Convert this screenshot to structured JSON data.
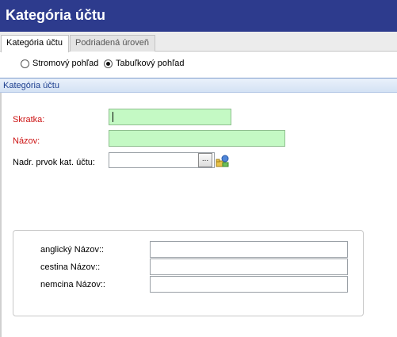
{
  "window": {
    "title": "Kategória účtu"
  },
  "tabs": [
    {
      "label": "Kategória účtu",
      "active": true
    },
    {
      "label": "Podriadená úroveň",
      "active": false
    }
  ],
  "view_toggle": {
    "options": [
      {
        "label": "Stromový pohľad",
        "checked": false
      },
      {
        "label": "Tabuľkový pohľad",
        "checked": true
      }
    ]
  },
  "section": {
    "title": "Kategória účtu"
  },
  "form": {
    "skratka": {
      "label": "Skratka:",
      "value": "",
      "required": true
    },
    "nazov": {
      "label": "Názov:",
      "value": "",
      "required": true
    },
    "nadr": {
      "label": "Nadr. prvok kat. účtu:",
      "value": "",
      "button": "..."
    }
  },
  "translations": {
    "fields": [
      {
        "label": "anglický Názov::",
        "value": ""
      },
      {
        "label": "cestina Názov::",
        "value": ""
      },
      {
        "label": "nemcina Názov::",
        "value": ""
      }
    ]
  },
  "colors": {
    "titlebar": "#2d3b8d",
    "required_label": "#cc1111",
    "required_input": "#c4f9c4",
    "section_text": "#1d3f8f"
  }
}
